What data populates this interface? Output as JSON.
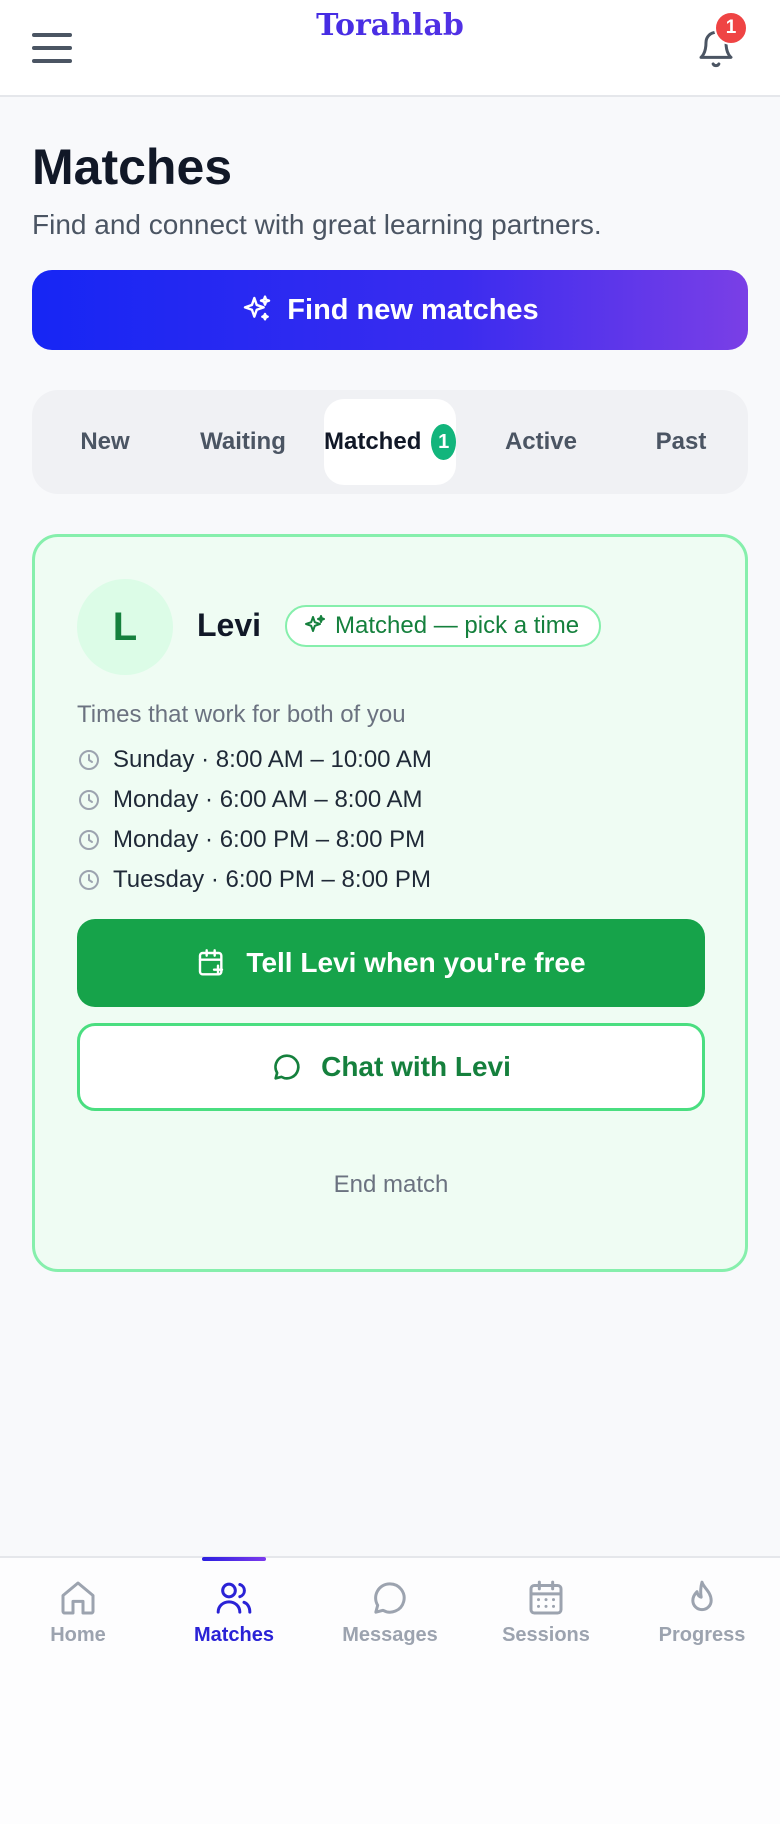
{
  "header": {
    "brand": "Torahlab",
    "notification_count": "1",
    "icons": {
      "menu": "hamburger-menu-icon",
      "bell": "bell-icon"
    }
  },
  "page": {
    "title": "Matches",
    "subtitle": "Find and connect with great learning partners.",
    "find_button_label": "Find new matches"
  },
  "tabs": [
    {
      "label": "New",
      "active": false
    },
    {
      "label": "Waiting",
      "active": false
    },
    {
      "label": "Matched",
      "active": true,
      "count": "1"
    },
    {
      "label": "Active",
      "active": false
    },
    {
      "label": "Past",
      "active": false
    }
  ],
  "match": {
    "avatar_initial": "L",
    "name": "Levi",
    "status": "Matched — pick a time",
    "times_heading": "Times that work for both of you",
    "slots": [
      "Sunday · 8:00 AM – 10:00 AM",
      "Monday · 6:00 AM – 8:00 AM",
      "Monday · 6:00 PM – 8:00 PM",
      "Tuesday · 6:00 PM – 8:00 PM"
    ],
    "primary_action": "Tell Levi when you're free",
    "secondary_action": "Chat with Levi",
    "end_action": "End match"
  },
  "bottom_nav": [
    {
      "label": "Home",
      "icon": "home-icon",
      "active": false
    },
    {
      "label": "Matches",
      "icon": "users-icon",
      "active": true
    },
    {
      "label": "Messages",
      "icon": "chat-bubble-icon",
      "active": false
    },
    {
      "label": "Sessions",
      "icon": "calendar-icon",
      "active": false
    },
    {
      "label": "Progress",
      "icon": "flame-icon",
      "active": false
    }
  ],
  "colors": {
    "brand_gradient_start": "#1626f4",
    "brand_gradient_end": "#7a3fe6",
    "success": "#16a34a",
    "success_light": "#effcf3",
    "badge_red": "#ef4444",
    "tab_count": "#12b57c",
    "nav_active": "#2a22d6"
  }
}
